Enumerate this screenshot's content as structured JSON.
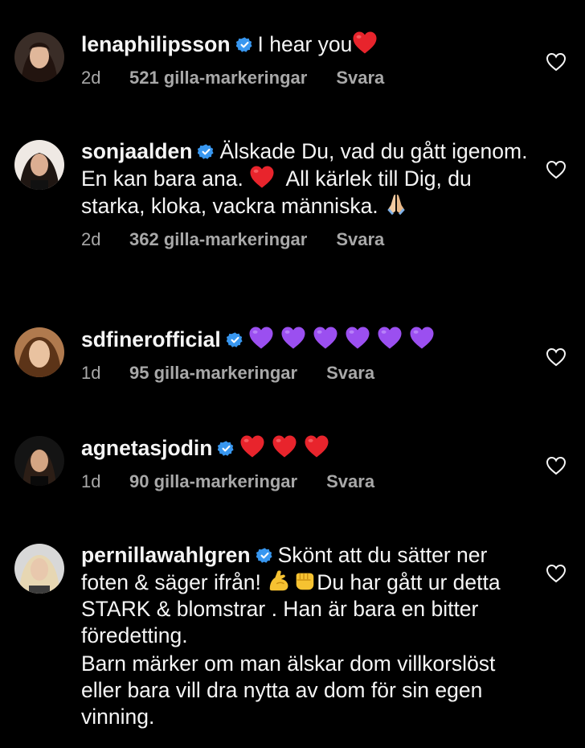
{
  "theme": {
    "background": "#000000",
    "text": "#f5f5f5",
    "muted": "#a8a8a8",
    "verified": "#3897f0"
  },
  "comments": [
    {
      "username": "lenaphilipsson",
      "verified": true,
      "text": "I hear you",
      "emojis": [
        "red-heart"
      ],
      "extra_text": "",
      "time": "2d",
      "likes": "521 gilla-markeringar",
      "reply": "Svara"
    },
    {
      "username": "sonjaalden",
      "verified": true,
      "text_part1": "Älskade Du, vad du gått igenom. En kan bara ana.",
      "text_part2": "All kärlek till Dig, du starka, kloka, vackra människa.",
      "emojis": [
        "red-heart",
        "folded-hands"
      ],
      "time": "2d",
      "likes": "362 gilla-markeringar",
      "reply": "Svara"
    },
    {
      "username": "sdfinerofficial",
      "verified": true,
      "text": "",
      "emojis": [
        "purple-heart",
        "purple-heart",
        "purple-heart",
        "purple-heart",
        "purple-heart",
        "purple-heart"
      ],
      "time": "1d",
      "likes": "95 gilla-markeringar",
      "reply": "Svara"
    },
    {
      "username": "agnetasjodin",
      "verified": true,
      "text": "",
      "emojis": [
        "red-heart",
        "red-heart",
        "red-heart"
      ],
      "time": "1d",
      "likes": "90 gilla-markeringar",
      "reply": "Svara"
    },
    {
      "username": "pernillawahlgren",
      "verified": true,
      "text_part1": "Skönt att du sätter ner foten & säger ifrån!",
      "text_part2": "Du har gått ur detta STARK & blomstrar . Han är bara en bitter föredetting.",
      "text_part3": "Barn märker om man älskar dom villkorslöst eller bara vill dra nytta av dom för sin egen vinning.",
      "emojis": [
        "flexed-biceps",
        "oncoming-fist"
      ]
    }
  ]
}
